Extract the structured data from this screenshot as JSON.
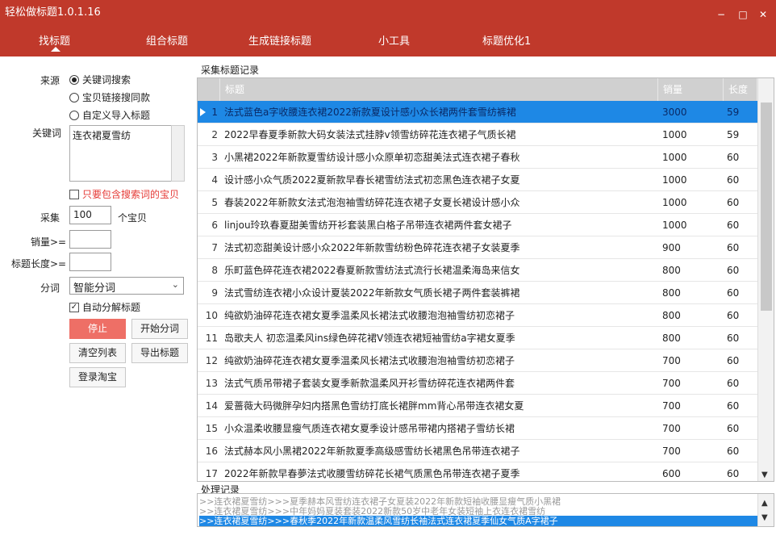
{
  "app": {
    "title": "轻松做标题1.0.1.16",
    "window_buttons": [
      "−",
      "□",
      "✕"
    ]
  },
  "nav": {
    "tabs": [
      "找标题",
      "组合标题",
      "生成链接标题",
      "小工具",
      "标题优化1"
    ],
    "active_index": 0
  },
  "left": {
    "source_label": "来源",
    "source_options": [
      "关键词搜索",
      "宝贝链接搜同款",
      "自定义导入标题"
    ],
    "source_selected": 0,
    "keyword_label": "关键词",
    "keyword_value": "连衣裙夏雪纺",
    "only_include_label": "只要包含搜索词的宝贝",
    "collect_label": "采集",
    "collect_value": "100",
    "collect_unit": "个宝贝",
    "sales_label": "销量>=",
    "sales_value": "",
    "title_len_label": "标题长度>=",
    "title_len_value": "",
    "seg_label": "分词",
    "seg_value": "智能分词",
    "auto_seg_label": "自动分解标题",
    "auto_seg_checked": true,
    "buttons": {
      "stop": "停止",
      "start_seg": "开始分词",
      "clear_list": "清空列表",
      "export": "导出标题",
      "login": "登录淘宝"
    }
  },
  "records": {
    "section_title": "采集标题记录",
    "columns": [
      "标题",
      "销量",
      "长度"
    ],
    "selected_row": 0,
    "rows": [
      {
        "n": "1",
        "title": "法式蓝色a字收腰连衣裙2022新款夏设计感小众长裙两件套雪纺裤裙",
        "sales": "3000",
        "len": "59"
      },
      {
        "n": "2",
        "title": "2022早春夏季新款大码女装法式挂脖v领雪纺碎花连衣裙子气质长裙",
        "sales": "1000",
        "len": "59"
      },
      {
        "n": "3",
        "title": "小黑裙2022年新款夏雪纺设计感小众原单初恋甜美法式连衣裙子春秋",
        "sales": "1000",
        "len": "60"
      },
      {
        "n": "4",
        "title": "设计感小众气质2022夏新款早春长裙雪纺法式初恋黑色连衣裙子女夏",
        "sales": "1000",
        "len": "60"
      },
      {
        "n": "5",
        "title": "春装2022年新款女法式泡泡袖雪纺碎花连衣裙子女夏长裙设计感小众",
        "sales": "1000",
        "len": "60"
      },
      {
        "n": "6",
        "title": "linjou玲玖春夏甜美雪纺开衫套装黑白格子吊带连衣裙两件套女裙子",
        "sales": "1000",
        "len": "60"
      },
      {
        "n": "7",
        "title": "法式初恋甜美设计感小众2022年新款雪纺粉色碎花连衣裙子女装夏季",
        "sales": "900",
        "len": "60"
      },
      {
        "n": "8",
        "title": "乐町蓝色碎花连衣裙2022春夏新款雪纺法式流行长裙温柔海岛来信女",
        "sales": "800",
        "len": "60"
      },
      {
        "n": "9",
        "title": "法式雪纺连衣裙小众设计夏装2022年新款女气质长裙子两件套装裤裙",
        "sales": "800",
        "len": "60"
      },
      {
        "n": "10",
        "title": "纯欲奶油碎花连衣裙女夏季温柔风长裙法式收腰泡泡袖雪纺初恋裙子",
        "sales": "800",
        "len": "60"
      },
      {
        "n": "11",
        "title": "岛歌夫人 初恋温柔风ins绿色碎花裙V领连衣裙短袖雪纺a字裙女夏季",
        "sales": "800",
        "len": "60"
      },
      {
        "n": "12",
        "title": "纯欲奶油碎花连衣裙女夏季温柔风长裙法式收腰泡泡袖雪纺初恋裙子",
        "sales": "700",
        "len": "60"
      },
      {
        "n": "13",
        "title": "法式气质吊带裙子套装女夏季新款温柔风开衫雪纺碎花连衣裙两件套",
        "sales": "700",
        "len": "60"
      },
      {
        "n": "14",
        "title": "爱蔷薇大码微胖孕妇内搭黑色雪纺打底长裙胖mm背心吊带连衣裙女夏",
        "sales": "700",
        "len": "60"
      },
      {
        "n": "15",
        "title": "小众温柔收腰显瘦气质连衣裙女夏季设计感吊带裙内搭裙子雪纺长裙",
        "sales": "700",
        "len": "60"
      },
      {
        "n": "16",
        "title": "法式赫本风小黑裙2022年新款夏季高级感雪纺长裙黑色吊带连衣裙子",
        "sales": "700",
        "len": "60"
      },
      {
        "n": "17",
        "title": "2022年新款早春夢法式收腰雪纺碎花长裙气质黑色吊带连衣裙子夏季",
        "sales": "600",
        "len": "60"
      }
    ]
  },
  "log": {
    "section_title": "处理记录",
    "lines": [
      ">>连衣裙夏雪纺>>>夏季赫本风雪纺连衣裙子女夏装2022年新款短袖收腰显瘦气质小黑裙",
      ">>连衣裙夏雪纺>>>中年妈妈夏装套装2022新款50岁中老年女装短袖上衣连衣裙雪纺",
      ">>连衣裙夏雪纺>>>春秋季2022年新款温柔风雪纺长袖法式连衣裙夏季仙女气质A字裙子"
    ],
    "selected_line": 2
  },
  "colors": {
    "brand": "#c0392b",
    "selection": "#1e88e5",
    "stop_button": "#ee6f66",
    "warning_text": "#e53935"
  }
}
